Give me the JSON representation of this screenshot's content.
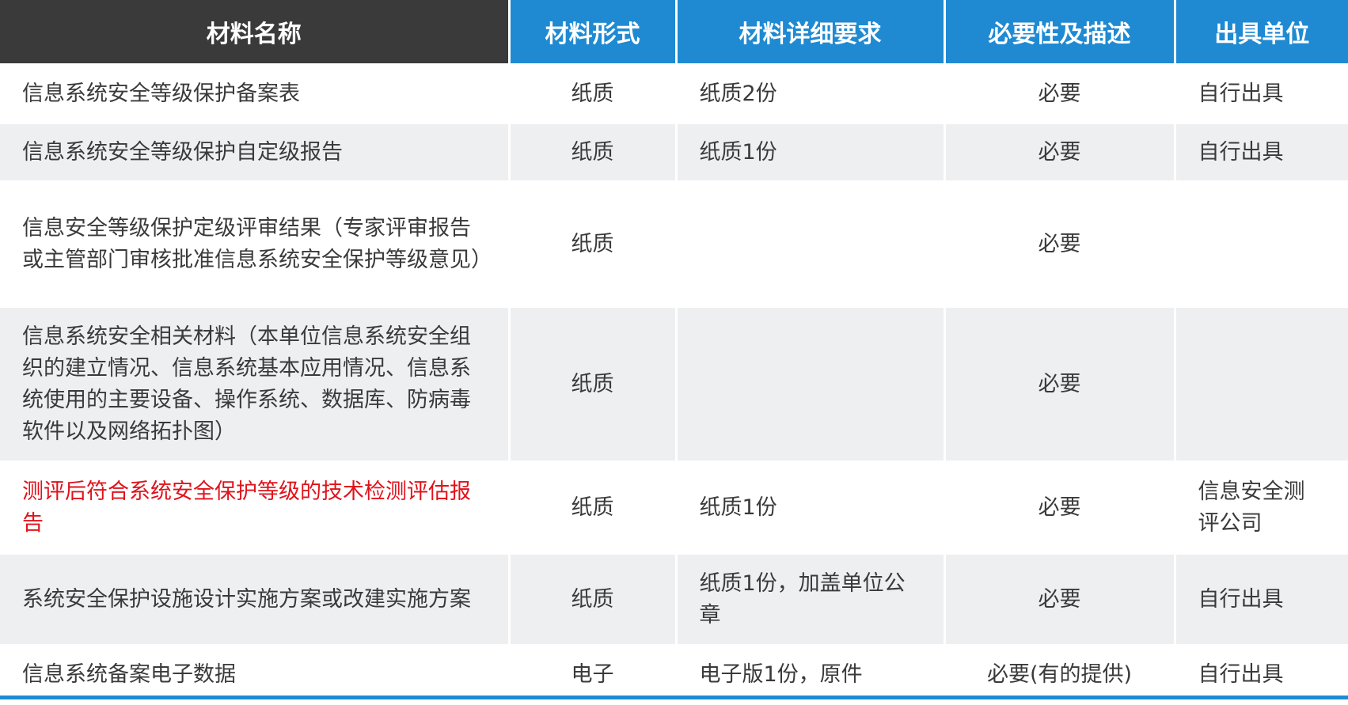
{
  "headers": [
    "材料名称",
    "材料形式",
    "材料详细要求",
    "必要性及描述",
    "出具单位"
  ],
  "rows": [
    {
      "name": "信息系统安全等级保护备案表",
      "form": "纸质",
      "detail": "纸质2份",
      "necessity": "必要",
      "issuer": "自行出具"
    },
    {
      "name": "信息系统安全等级保护自定级报告",
      "form": "纸质",
      "detail": "纸质1份",
      "necessity": "必要",
      "issuer": "自行出具"
    },
    {
      "name": "信息安全等级保护定级评审结果（专家评审报告或主管部门审核批准信息系统安全保护等级意见）",
      "form": "纸质",
      "detail": "",
      "necessity": "必要",
      "issuer": ""
    },
    {
      "name": "信息系统安全相关材料（本单位信息系统安全组织的建立情况、信息系统基本应用情况、信息系统使用的主要设备、操作系统、数据库、防病毒软件以及网络拓扑图）",
      "form": "纸质",
      "detail": "",
      "necessity": "必要",
      "issuer": ""
    },
    {
      "name": "测评后符合系统安全保护等级的技术检测评估报告",
      "form": "纸质",
      "detail": "纸质1份",
      "necessity": "必要",
      "issuer": "信息安全测评公司"
    },
    {
      "name": "系统安全保护设施设计实施方案或改建实施方案",
      "form": "纸质",
      "detail": "纸质1份，加盖单位公章",
      "necessity": "必要",
      "issuer": "自行出具"
    },
    {
      "name": "信息系统备案电子数据",
      "form": "电子",
      "detail": "电子版1份，原件",
      "necessity": "必要(有的提供)",
      "issuer": "自行出具"
    }
  ],
  "colors": {
    "header_dark": "#3a3a3a",
    "header_blue": "#1f8ad2",
    "row_alt": "#eeeff1",
    "text": "#3a3a3a",
    "highlight": "#e0121b"
  }
}
